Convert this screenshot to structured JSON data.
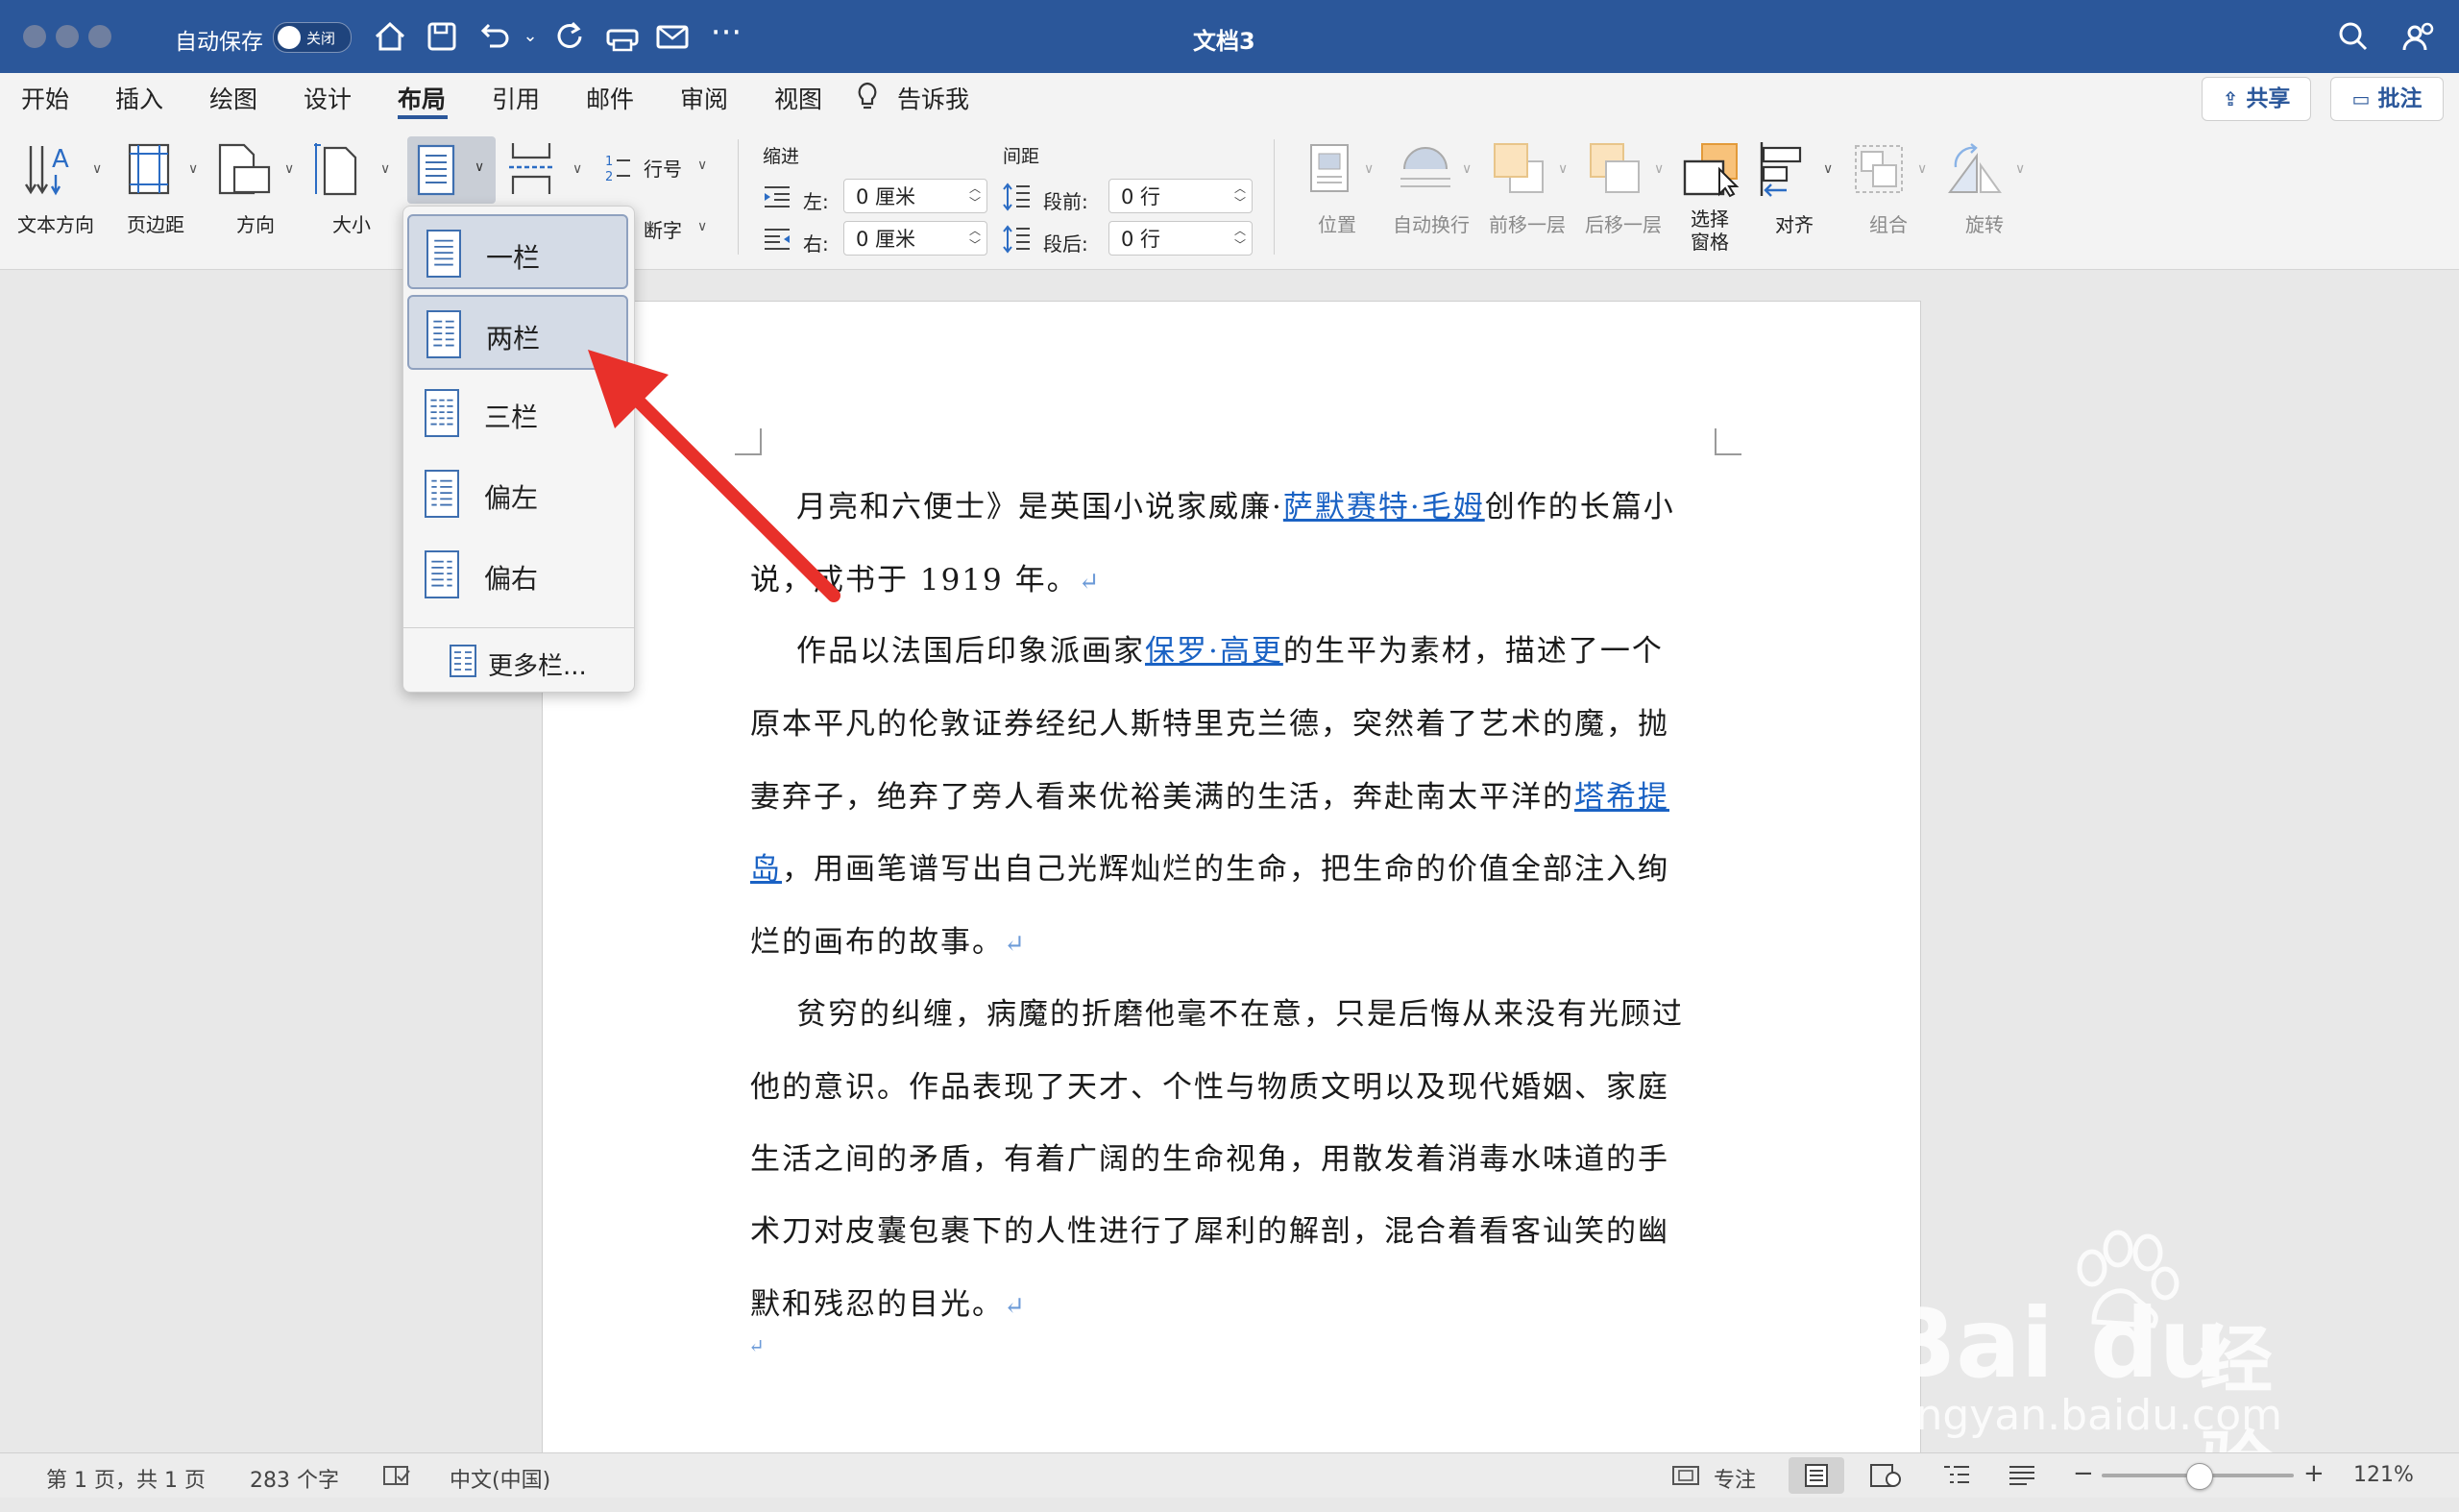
{
  "titlebar": {
    "autosave_label": "自动保存",
    "toggle_label": "关闭",
    "doc_title": "文档3"
  },
  "menu": {
    "items": [
      "开始",
      "插入",
      "绘图",
      "设计",
      "布局",
      "引用",
      "邮件",
      "审阅",
      "视图"
    ],
    "tell_me": "告诉我",
    "share": "共享",
    "comments": "批注"
  },
  "ribbon": {
    "text_direction": "文本方向",
    "margins": "页边距",
    "orientation": "方向",
    "size": "大小",
    "line_numbers": "行号",
    "hyphenation": "断字",
    "indent_title": "缩进",
    "spacing_title": "间距",
    "left_label": "左:",
    "right_label": "右:",
    "left_value": "0 厘米",
    "right_value": "0 厘米",
    "before_label": "段前:",
    "after_label": "段后:",
    "before_value": "0 行",
    "after_value": "0 行",
    "position": "位置",
    "wrap_text": "自动换行",
    "bring_forward": "前移一层",
    "send_backward": "后移一层",
    "selection_pane_1": "选择",
    "selection_pane_2": "窗格",
    "align": "对齐",
    "group": "组合",
    "rotate": "旋转"
  },
  "columns_menu": {
    "items": [
      "一栏",
      "两栏",
      "三栏",
      "偏左",
      "偏右"
    ],
    "more": "更多栏..."
  },
  "document": {
    "p1_l1_a": "月亮和六便士》是英国小说家威廉·",
    "p1_l1_link": "萨默赛特·毛姆",
    "p1_l1_b": "创作的长篇小",
    "p1_l2": "说，成书于 1919 年。",
    "p2_l1_a": "作品以法国后印象派画家",
    "p2_l1_link": "保罗·高更",
    "p2_l1_b": "的生平为素材，描述了一个",
    "p2_l2": "原本平凡的伦敦证券经纪人斯特里克兰德，突然着了艺术的魔，抛",
    "p2_l3_a": "妻弃子，绝弃了旁人看来优裕美满的生活，奔赴南太平洋的",
    "p2_l3_link": "塔希提",
    "p2_l4_link": "岛",
    "p2_l4_b": "，用画笔谱写出自己光辉灿烂的生命，把生命的价值全部注入绚",
    "p2_l5": "烂的画布的故事。",
    "p3_l1": "贫穷的纠缠，病魔的折磨他毫不在意，只是后悔从来没有光顾过",
    "p3_l2": "他的意识。作品表现了天才、个性与物质文明以及现代婚姻、家庭",
    "p3_l3": "生活之间的矛盾，有着广阔的生命视角，用散发着消毒水味道的手",
    "p3_l4": "术刀对皮囊包裹下的人性进行了犀利的解剖，混合着看客讪笑的幽",
    "p3_l5": "默和残忍的目光。",
    "para_mark": "↵"
  },
  "status": {
    "page": "第 1 页，共 1 页",
    "words": "283 个字",
    "language": "中文(中国)",
    "focus": "专注",
    "zoom": "121%"
  },
  "watermark": {
    "brand": "Bai",
    "brand2": "du",
    "jingyan": "经验",
    "url": "jingyan.baidu.com"
  },
  "colors": {
    "title_bar": "#2b579a",
    "link": "#1a62c4",
    "arrow": "#e8302a"
  }
}
